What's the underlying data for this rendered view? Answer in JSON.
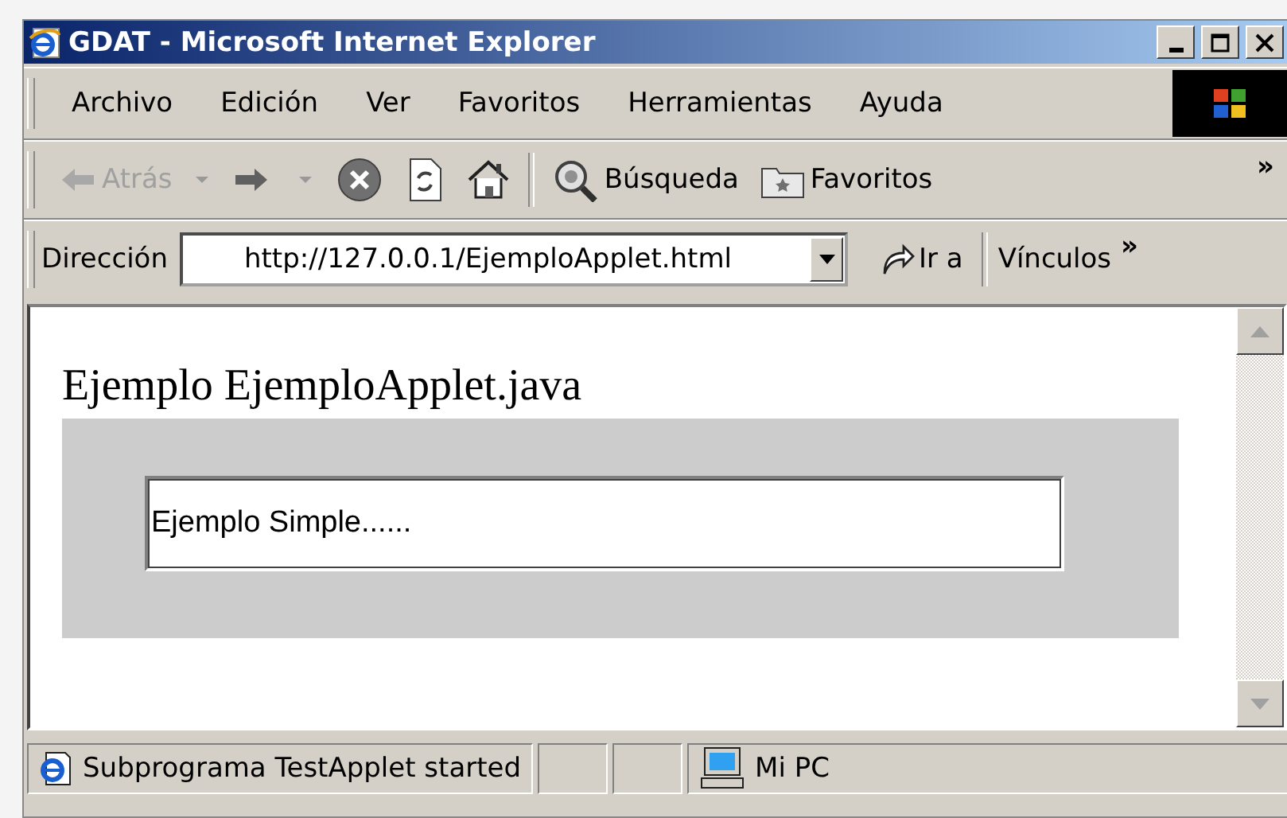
{
  "window": {
    "title": "GDAT - Microsoft Internet Explorer"
  },
  "menu": [
    "Archivo",
    "Edición",
    "Ver",
    "Favoritos",
    "Herramientas",
    "Ayuda"
  ],
  "toolbar": {
    "buttons": [
      {
        "kind": "back",
        "label": "Atrás",
        "disabled": true
      },
      {
        "kind": "forward",
        "disabled": false
      },
      {
        "kind": "stop"
      },
      {
        "kind": "refresh"
      },
      {
        "kind": "home"
      },
      {
        "kind": "search",
        "label": "Búsqueda"
      },
      {
        "kind": "favorites",
        "label": "Favoritos"
      }
    ],
    "overflow": "»"
  },
  "address": {
    "label": "Dirección",
    "value": "http://127.0.0.1/EjemploApplet.html",
    "go": "Ir a",
    "links": "Vínculos",
    "overflow": "»"
  },
  "page": {
    "heading": "Ejemplo EjemploApplet.java",
    "applet_text": "Ejemplo Simple......"
  },
  "status_bar": {
    "message": "Subprograma TestApplet started",
    "zone": "Mi PC"
  }
}
